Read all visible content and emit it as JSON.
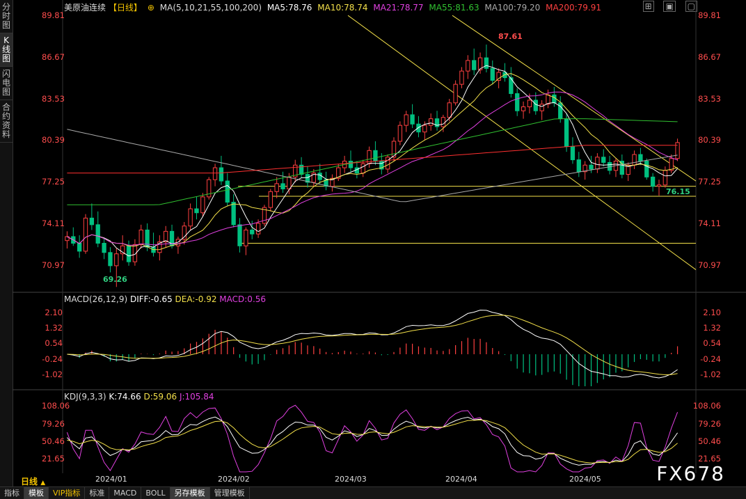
{
  "sidebar": {
    "tabs": [
      {
        "label": "分时图"
      },
      {
        "label": "K线图"
      },
      {
        "label": "闪电图"
      },
      {
        "label": "合约资料"
      }
    ]
  },
  "header": {
    "title": "美原油连续",
    "period": "【日线】",
    "ma_params": "MA(5,10,21,55,100,200)",
    "ma5": "MA5:78.76",
    "ma10": "MA10:78.74",
    "ma21": "MA21:78.77",
    "ma55": "MA55:81.63",
    "ma100": "MA100:79.20",
    "ma200": "MA200:79.91"
  },
  "macd_header": {
    "params": "MACD(26,12,9)",
    "diff": "DIFF:-0.65",
    "dea": "DEA:-0.92",
    "macd": "MACD:0.56"
  },
  "kdj_header": {
    "params": "KDJ(9,3,3)",
    "k": "K:74.66",
    "d": "D:59.06",
    "j": "J:105.84"
  },
  "annotations": {
    "high": "87.61",
    "low1": "69.26",
    "low2": "76.15"
  },
  "date_labels": [
    "2024/01",
    "2024/02",
    "2024/03",
    "2024/04",
    "2024/05"
  ],
  "period_selector": "日线",
  "bottom_tabs": [
    {
      "label": "指标"
    },
    {
      "label": "模板"
    },
    {
      "label": "VIP指标"
    },
    {
      "label": "标准"
    },
    {
      "label": "MACD"
    },
    {
      "label": "BOLL"
    },
    {
      "label": "另存模板"
    },
    {
      "label": "管理模板"
    }
  ],
  "watermark": "FX678",
  "colors": {
    "up": "#ff4040",
    "down": "#00c080",
    "ma5": "#ffffff",
    "ma10": "#f3e04a",
    "ma21": "#e040e0",
    "ma55": "#30c030",
    "ma100": "#aaaaaa",
    "ma200": "#ff3030"
  },
  "chart_data": [
    {
      "type": "candlestick",
      "title": "美原油连续【日线】",
      "ylim": [
        69.0,
        89.81
      ],
      "yticks": [
        "89.81",
        "86.67",
        "83.53",
        "80.39",
        "77.25",
        "74.11",
        "70.97"
      ],
      "high_mark": 87.61,
      "low_mark_1": 69.26,
      "low_mark_2": 76.15,
      "ohlc": [
        [
          72.8,
          73.5,
          72.2,
          73.1
        ],
        [
          73.1,
          73.8,
          72.4,
          72.6
        ],
        [
          72.6,
          73.2,
          71.5,
          72.0
        ],
        [
          72.0,
          74.8,
          71.8,
          74.5
        ],
        [
          74.5,
          75.6,
          73.6,
          74.0
        ],
        [
          74.0,
          75.0,
          72.3,
          72.6
        ],
        [
          72.6,
          73.0,
          71.4,
          71.9
        ],
        [
          71.9,
          72.3,
          70.4,
          70.9
        ],
        [
          70.9,
          72.2,
          69.3,
          71.8
        ],
        [
          71.8,
          73.2,
          71.3,
          72.4
        ],
        [
          72.4,
          72.8,
          70.9,
          71.2
        ],
        [
          71.2,
          72.9,
          70.9,
          72.5
        ],
        [
          72.5,
          74.0,
          72.2,
          73.6
        ],
        [
          73.6,
          74.1,
          72.0,
          72.3
        ],
        [
          72.3,
          73.4,
          71.6,
          71.9
        ],
        [
          71.9,
          73.2,
          71.3,
          72.7
        ],
        [
          72.7,
          73.9,
          72.3,
          73.5
        ],
        [
          73.5,
          74.0,
          72.2,
          72.4
        ],
        [
          72.4,
          73.1,
          71.8,
          72.9
        ],
        [
          72.9,
          74.2,
          72.5,
          73.9
        ],
        [
          73.9,
          75.6,
          73.6,
          75.2
        ],
        [
          75.2,
          76.1,
          74.4,
          74.9
        ],
        [
          74.9,
          76.4,
          74.6,
          76.1
        ],
        [
          76.1,
          77.6,
          75.9,
          77.4
        ],
        [
          77.4,
          78.6,
          76.9,
          78.3
        ],
        [
          78.3,
          79.2,
          77.0,
          77.3
        ],
        [
          77.3,
          77.9,
          75.4,
          75.7
        ],
        [
          75.7,
          76.3,
          73.8,
          74.0
        ],
        [
          74.0,
          74.5,
          71.9,
          72.4
        ],
        [
          72.4,
          73.8,
          71.7,
          73.6
        ],
        [
          73.6,
          74.3,
          72.9,
          73.3
        ],
        [
          73.3,
          74.4,
          73.0,
          74.1
        ],
        [
          74.1,
          75.5,
          73.9,
          75.3
        ],
        [
          75.3,
          76.7,
          75.0,
          76.5
        ],
        [
          76.5,
          77.6,
          76.0,
          77.1
        ],
        [
          77.1,
          78.0,
          76.4,
          76.7
        ],
        [
          76.7,
          77.9,
          76.3,
          77.6
        ],
        [
          77.6,
          78.9,
          77.2,
          78.5
        ],
        [
          78.5,
          79.1,
          77.5,
          77.8
        ],
        [
          77.8,
          78.4,
          76.8,
          77.2
        ],
        [
          77.2,
          78.2,
          76.9,
          77.9
        ],
        [
          77.9,
          78.6,
          77.1,
          77.4
        ],
        [
          77.4,
          78.0,
          76.6,
          76.9
        ],
        [
          76.9,
          77.8,
          76.5,
          77.5
        ],
        [
          77.5,
          78.6,
          77.3,
          78.3
        ],
        [
          78.3,
          79.2,
          77.9,
          78.8
        ],
        [
          78.8,
          79.6,
          78.0,
          78.3
        ],
        [
          78.3,
          78.8,
          77.5,
          77.9
        ],
        [
          77.9,
          78.9,
          77.6,
          78.6
        ],
        [
          78.6,
          79.9,
          78.3,
          79.6
        ],
        [
          79.6,
          80.3,
          78.5,
          78.8
        ],
        [
          78.8,
          79.4,
          77.8,
          78.2
        ],
        [
          78.2,
          79.3,
          77.9,
          79.1
        ],
        [
          79.1,
          80.6,
          78.8,
          80.3
        ],
        [
          80.3,
          81.8,
          80.0,
          81.5
        ],
        [
          81.5,
          82.6,
          81.0,
          82.3
        ],
        [
          82.3,
          83.1,
          81.3,
          81.6
        ],
        [
          81.6,
          82.2,
          80.6,
          81.0
        ],
        [
          81.0,
          81.8,
          80.4,
          81.5
        ],
        [
          81.5,
          82.4,
          81.1,
          82.0
        ],
        [
          82.0,
          82.6,
          81.1,
          81.4
        ],
        [
          81.4,
          82.3,
          81.0,
          82.1
        ],
        [
          82.1,
          83.5,
          81.8,
          83.2
        ],
        [
          83.2,
          84.9,
          83.0,
          84.6
        ],
        [
          84.6,
          85.9,
          84.3,
          85.6
        ],
        [
          85.6,
          86.8,
          85.0,
          86.4
        ],
        [
          86.4,
          87.3,
          85.3,
          85.7
        ],
        [
          85.7,
          87.0,
          85.4,
          86.6
        ],
        [
          86.6,
          87.6,
          85.5,
          85.8
        ],
        [
          85.8,
          86.4,
          84.6,
          84.9
        ],
        [
          84.9,
          85.8,
          84.3,
          85.5
        ],
        [
          85.5,
          86.2,
          84.8,
          85.1
        ],
        [
          85.1,
          85.9,
          83.6,
          83.9
        ],
        [
          83.9,
          84.3,
          82.2,
          82.6
        ],
        [
          82.6,
          83.3,
          82.0,
          82.9
        ],
        [
          82.9,
          83.9,
          82.4,
          83.4
        ],
        [
          83.4,
          84.0,
          82.3,
          82.6
        ],
        [
          82.6,
          83.4,
          81.9,
          83.1
        ],
        [
          83.1,
          84.2,
          82.8,
          83.8
        ],
        [
          83.8,
          84.4,
          82.9,
          83.2
        ],
        [
          83.2,
          83.7,
          81.7,
          82.0
        ],
        [
          82.0,
          82.4,
          79.5,
          79.9
        ],
        [
          79.9,
          80.6,
          78.6,
          78.9
        ],
        [
          78.9,
          79.5,
          77.6,
          78.0
        ],
        [
          78.0,
          78.8,
          77.4,
          78.5
        ],
        [
          78.5,
          79.2,
          77.9,
          78.2
        ],
        [
          78.2,
          79.4,
          77.9,
          79.1
        ],
        [
          79.1,
          79.7,
          78.4,
          78.7
        ],
        [
          78.7,
          79.2,
          77.8,
          78.1
        ],
        [
          78.1,
          79.0,
          77.6,
          78.8
        ],
        [
          78.8,
          79.3,
          77.5,
          77.8
        ],
        [
          77.8,
          78.7,
          77.3,
          78.5
        ],
        [
          78.5,
          79.6,
          78.2,
          79.3
        ],
        [
          79.3,
          79.8,
          78.5,
          78.8
        ],
        [
          78.8,
          79.0,
          77.4,
          77.6
        ],
        [
          77.6,
          77.9,
          76.5,
          76.9
        ],
        [
          76.9,
          77.4,
          76.2,
          77.0
        ],
        [
          77.0,
          78.4,
          76.8,
          78.1
        ],
        [
          78.1,
          79.3,
          77.9,
          79.0
        ],
        [
          79.0,
          80.5,
          78.8,
          80.2
        ]
      ]
    },
    {
      "type": "macd",
      "yticks": [
        "2.10",
        "1.32",
        "0.54",
        "-0.24",
        "-1.02"
      ],
      "ylim": [
        -1.6,
        2.4
      ],
      "diff": -0.65,
      "dea": -0.92,
      "macd": 0.56
    },
    {
      "type": "kdj",
      "yticks": [
        "108.06",
        "79.26",
        "50.46",
        "21.65"
      ],
      "ylim": [
        0,
        112
      ],
      "k": 74.66,
      "d": 59.06,
      "j": 105.84
    }
  ]
}
